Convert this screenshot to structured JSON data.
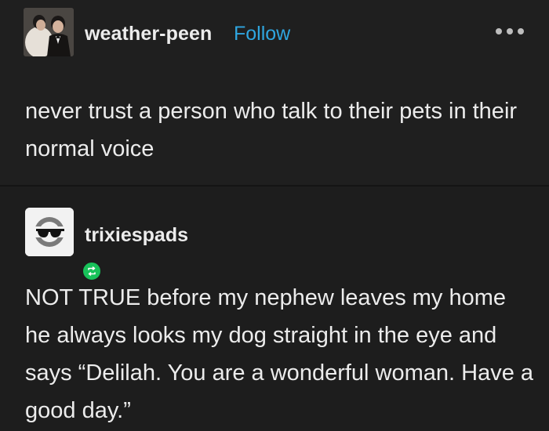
{
  "original_post": {
    "username": "weather-peen",
    "follow_label": "Follow",
    "more_icon": "more-options-icon",
    "text": "never trust a person who talk to their pets in their normal voice"
  },
  "reblog": {
    "username": "trixiespads",
    "badge_icon": "reblog-icon",
    "text": "NOT TRUE before my nephew leaves my home he always looks my dog straight in the eye and says “Delilah.  You are a wonderful woman.  Have a good day.”"
  },
  "colors": {
    "background": "#1e1e1e",
    "text": "#ececec",
    "follow_link": "#2fa6e0",
    "reblog_badge": "#18c25a"
  }
}
